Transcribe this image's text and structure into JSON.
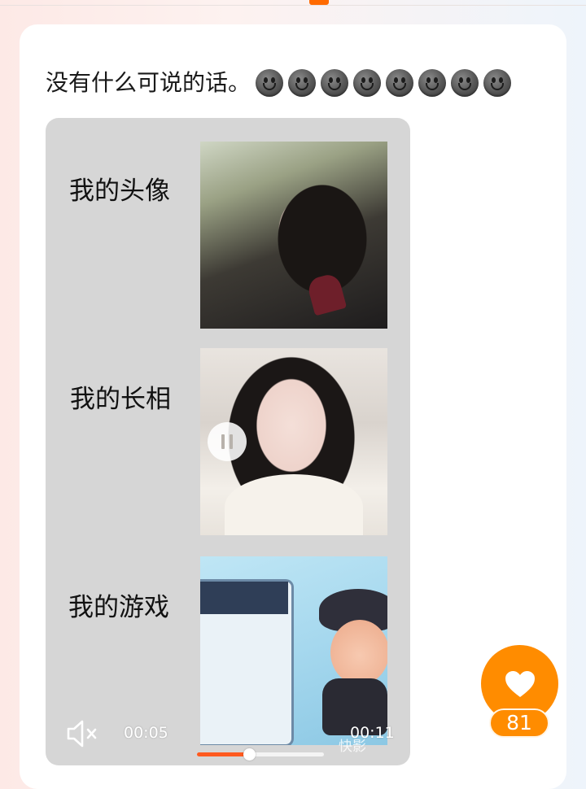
{
  "post": {
    "caption": "没有什么可说的话。",
    "emoji_icon": "grinning-face-icon",
    "emoji_count": 8
  },
  "media": {
    "rows": [
      {
        "label": "我的头像"
      },
      {
        "label": "我的长相"
      },
      {
        "label": "我的游戏"
      }
    ],
    "video": {
      "current_time": "00:05",
      "duration": "00:11",
      "progress": 0.41,
      "watermark": "快影",
      "muted": true
    }
  },
  "like": {
    "count": "81",
    "button_color": "#ff8c00"
  },
  "colors": {
    "accent": "#ff6a00",
    "progress": "#ff5a1f"
  }
}
